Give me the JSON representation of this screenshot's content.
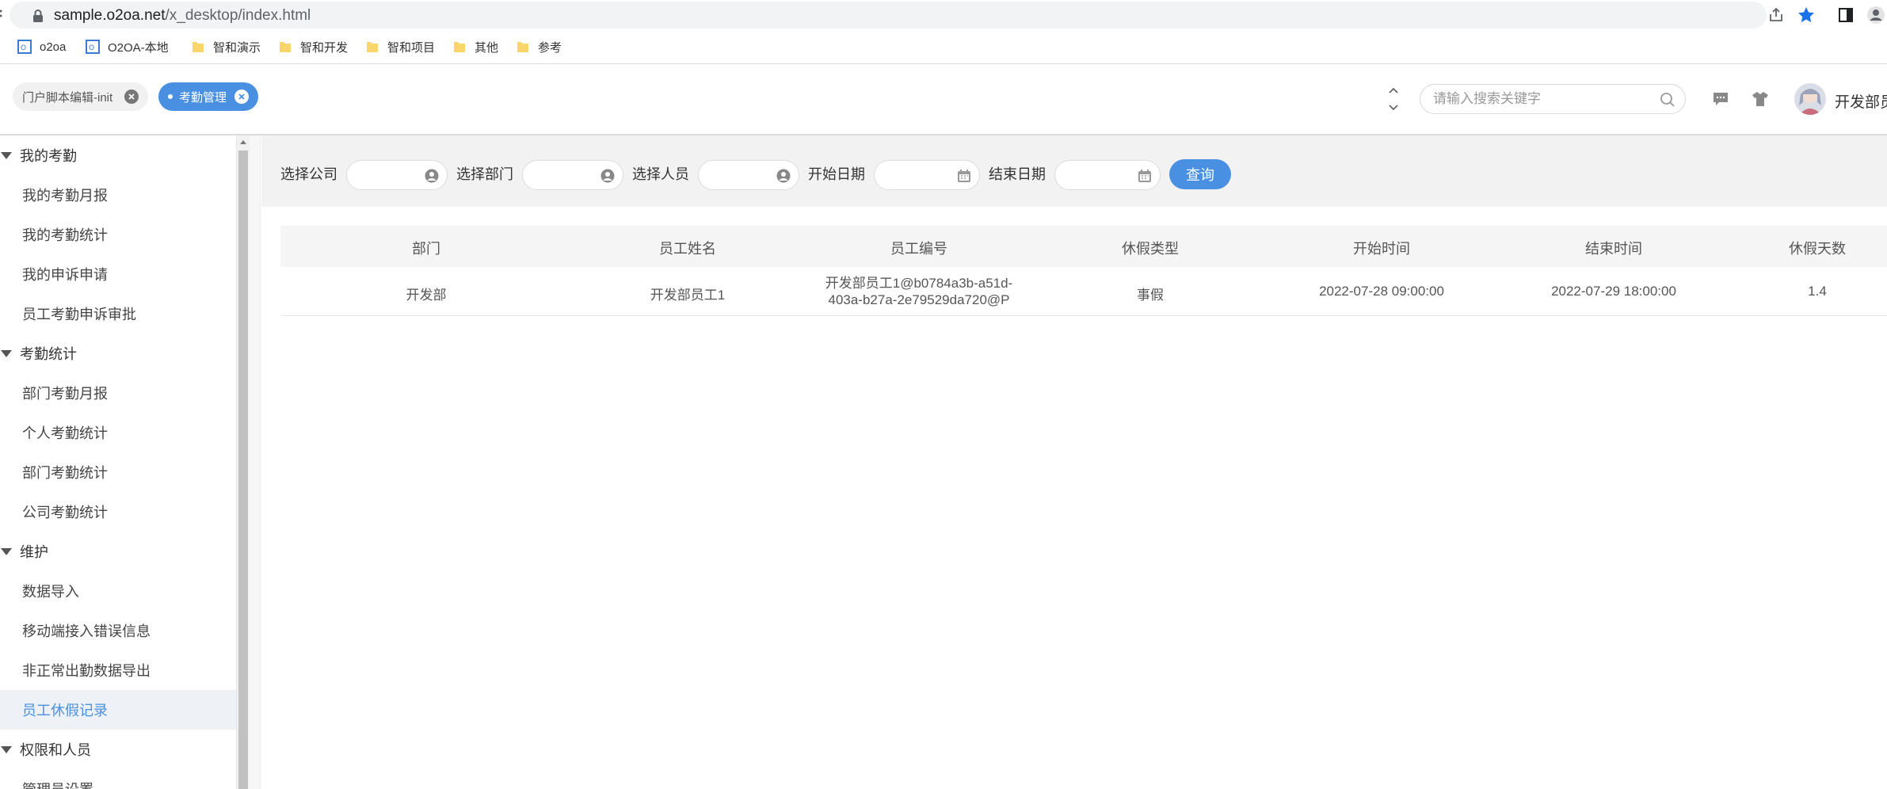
{
  "browser": {
    "url_host": "sample.o2oa.net",
    "url_path": "/x_desktop/index.html",
    "bookmarks": [
      {
        "label": "o2oa",
        "icon": "o2-icon"
      },
      {
        "label": "O2OA-本地",
        "icon": "o2-icon"
      },
      {
        "label": "智和演示",
        "icon": "folder-icon"
      },
      {
        "label": "智和开发",
        "icon": "folder-icon"
      },
      {
        "label": "智和项目",
        "icon": "folder-icon"
      },
      {
        "label": "其他",
        "icon": "folder-icon"
      },
      {
        "label": "参考",
        "icon": "folder-icon"
      }
    ]
  },
  "header": {
    "tabs": [
      {
        "label": "门户脚本编辑-init",
        "active": false
      },
      {
        "label": "考勤管理",
        "active": true
      }
    ],
    "search_placeholder": "请输入搜索关键字",
    "username": "开发部员"
  },
  "sidebar": {
    "groups": [
      {
        "label": "我的考勤",
        "items": [
          "我的考勤月报",
          "我的考勤统计",
          "我的申诉申请",
          "员工考勤申诉审批"
        ]
      },
      {
        "label": "考勤统计",
        "items": [
          "部门考勤月报",
          "个人考勤统计",
          "部门考勤统计",
          "公司考勤统计"
        ]
      },
      {
        "label": "维护",
        "items": [
          "数据导入",
          "移动端接入错误信息",
          "非正常出勤数据导出",
          "员工休假记录"
        ]
      },
      {
        "label": "权限和人员",
        "items": [
          "管理员设置"
        ]
      }
    ],
    "active_item": "员工休假记录"
  },
  "filters": {
    "company_label": "选择公司",
    "department_label": "选择部门",
    "person_label": "选择人员",
    "start_date_label": "开始日期",
    "end_date_label": "结束日期",
    "query_button": "查询"
  },
  "table": {
    "columns": [
      "部门",
      "员工姓名",
      "员工编号",
      "休假类型",
      "开始时间",
      "结束时间",
      "休假天数"
    ],
    "rows": [
      {
        "department": "开发部",
        "name": "开发部员工1",
        "employee_id_line1": "开发部员工1@b0784a3b-a51d-",
        "employee_id_line2": "403a-b27a-2e79529da720@P",
        "leave_type": "事假",
        "start_time": "2022-07-28 09:00:00",
        "end_time": "2022-07-29 18:00:00",
        "days": "1.4"
      }
    ]
  },
  "colors": {
    "accent": "#4a90e2",
    "filter_bg": "#f2f2f2",
    "sidebar_active_bg": "#eef1f5"
  }
}
